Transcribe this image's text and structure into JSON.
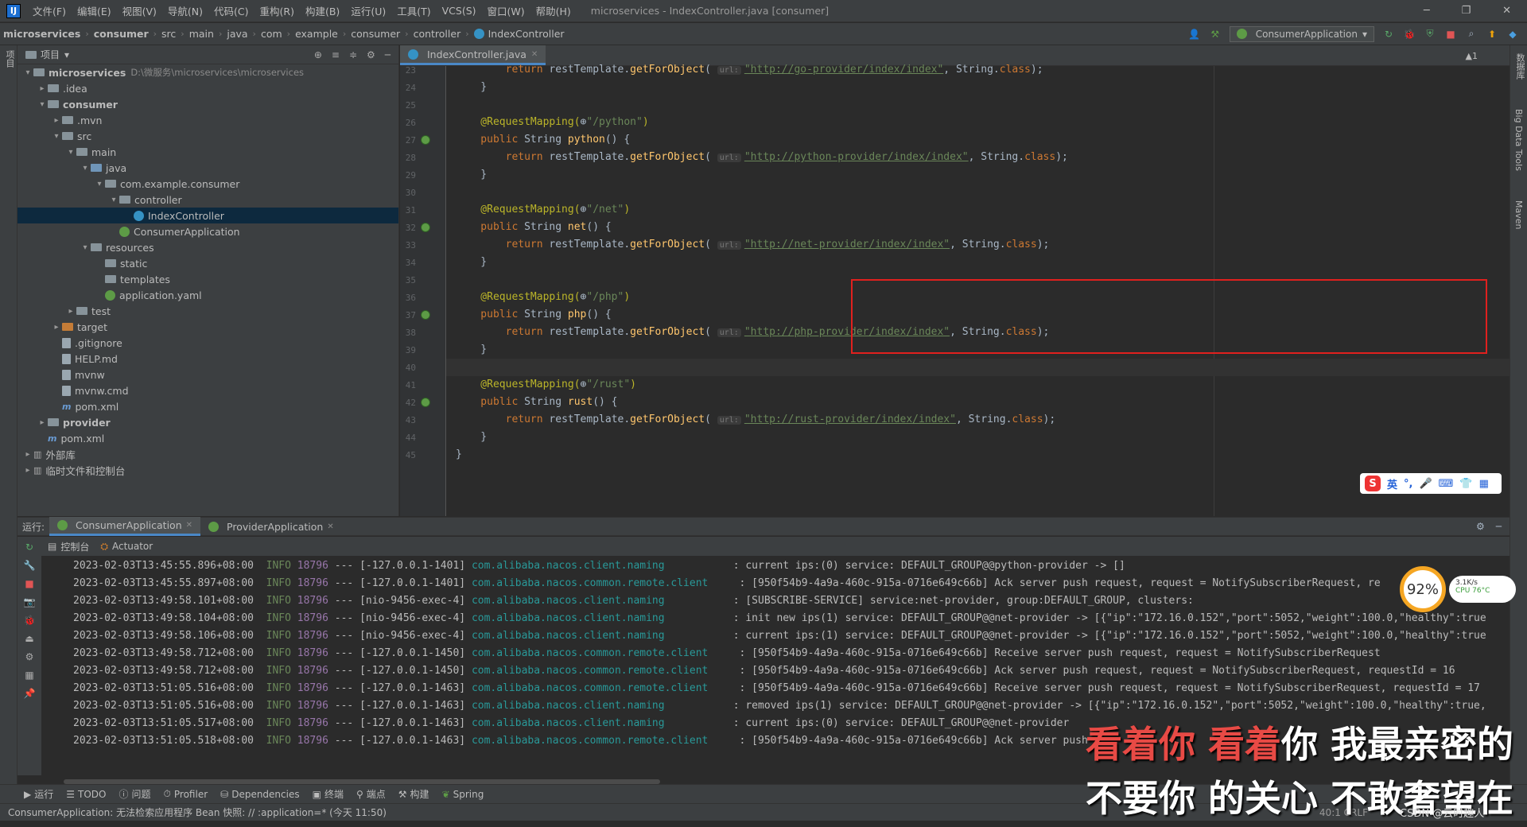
{
  "menubar": {
    "logo": "IJ",
    "items": [
      "文件(F)",
      "编辑(E)",
      "视图(V)",
      "导航(N)",
      "代码(C)",
      "重构(R)",
      "构建(B)",
      "运行(U)",
      "工具(T)",
      "VCS(S)",
      "窗口(W)",
      "帮助(H)"
    ],
    "title": "microservices - IndexController.java [consumer]"
  },
  "breadcrumb": [
    "microservices",
    "consumer",
    "src",
    "main",
    "java",
    "com",
    "example",
    "consumer",
    "controller",
    "IndexController"
  ],
  "run_config": "ConsumerApplication",
  "left_strip": {
    "project_label": "项目"
  },
  "right_strip": {
    "db_label": "数据库",
    "bigdata_label": "Big Data Tools",
    "maven_label": "Maven"
  },
  "project": {
    "header": "项目",
    "tree": [
      {
        "label": "microservices",
        "path": "D:\\微服务\\microservices\\microservices",
        "indent": 0,
        "arrow": "▾",
        "icon": "folder",
        "bold": true
      },
      {
        "label": ".idea",
        "indent": 1,
        "arrow": "▸",
        "icon": "folder"
      },
      {
        "label": "consumer",
        "indent": 1,
        "arrow": "▾",
        "icon": "folder",
        "bold": true
      },
      {
        "label": ".mvn",
        "indent": 2,
        "arrow": "▸",
        "icon": "folder"
      },
      {
        "label": "src",
        "indent": 2,
        "arrow": "▾",
        "icon": "folder"
      },
      {
        "label": "main",
        "indent": 3,
        "arrow": "▾",
        "icon": "folder"
      },
      {
        "label": "java",
        "indent": 4,
        "arrow": "▾",
        "icon": "folder-blue"
      },
      {
        "label": "com.example.consumer",
        "indent": 5,
        "arrow": "▾",
        "icon": "folder"
      },
      {
        "label": "controller",
        "indent": 6,
        "arrow": "▾",
        "icon": "folder"
      },
      {
        "label": "IndexController",
        "indent": 7,
        "arrow": "",
        "icon": "class",
        "selected": true
      },
      {
        "label": "ConsumerApplication",
        "indent": 6,
        "arrow": "",
        "icon": "spring"
      },
      {
        "label": "resources",
        "indent": 4,
        "arrow": "▾",
        "icon": "folder"
      },
      {
        "label": "static",
        "indent": 5,
        "arrow": "",
        "icon": "folder"
      },
      {
        "label": "templates",
        "indent": 5,
        "arrow": "",
        "icon": "folder"
      },
      {
        "label": "application.yaml",
        "indent": 5,
        "arrow": "",
        "icon": "spring"
      },
      {
        "label": "test",
        "indent": 3,
        "arrow": "▸",
        "icon": "folder"
      },
      {
        "label": "target",
        "indent": 2,
        "arrow": "▸",
        "icon": "folder-orange"
      },
      {
        "label": ".gitignore",
        "indent": 2,
        "arrow": "",
        "icon": "file"
      },
      {
        "label": "HELP.md",
        "indent": 2,
        "arrow": "",
        "icon": "file"
      },
      {
        "label": "mvnw",
        "indent": 2,
        "arrow": "",
        "icon": "file"
      },
      {
        "label": "mvnw.cmd",
        "indent": 2,
        "arrow": "",
        "icon": "file"
      },
      {
        "label": "pom.xml",
        "indent": 2,
        "arrow": "",
        "icon": "maven"
      },
      {
        "label": "provider",
        "indent": 1,
        "arrow": "▸",
        "icon": "folder",
        "bold": true
      },
      {
        "label": "pom.xml",
        "indent": 1,
        "arrow": "",
        "icon": "maven"
      },
      {
        "label": "外部库",
        "indent": 0,
        "arrow": "▸",
        "icon": "lib"
      },
      {
        "label": "临时文件和控制台",
        "indent": 0,
        "arrow": "▸",
        "icon": "lib"
      }
    ]
  },
  "editor": {
    "tab": "IndexController.java",
    "inspection": "▲1",
    "cursor_line": 40,
    "lines": [
      {
        "n": 23,
        "parts": [
          [
            "",
            "        "
          ],
          [
            "kw",
            "return "
          ],
          [
            "",
            "restTemplate."
          ],
          [
            "fn",
            "getForObject"
          ],
          [
            "",
            "( "
          ],
          [
            "hint",
            "url:"
          ],
          [
            "url",
            "\"http://go-provider/index/index\""
          ],
          [
            "",
            ", String."
          ],
          [
            "kw",
            "class"
          ],
          [
            "",
            ");"
          ]
        ]
      },
      {
        "n": 24,
        "parts": [
          [
            "",
            "    }"
          ]
        ]
      },
      {
        "n": 25,
        "parts": []
      },
      {
        "n": 26,
        "parts": [
          [
            "ann",
            "    @RequestMapping("
          ],
          [
            "",
            "⊕"
          ],
          [
            "str",
            "\"/python\""
          ],
          [
            "ann",
            ")"
          ]
        ]
      },
      {
        "n": 27,
        "parts": [
          [
            "kw",
            "    public "
          ],
          [
            "",
            "String "
          ],
          [
            "fn",
            "python"
          ],
          [
            "",
            "() {"
          ]
        ],
        "gicon": true
      },
      {
        "n": 28,
        "parts": [
          [
            "",
            "        "
          ],
          [
            "kw",
            "return "
          ],
          [
            "",
            "restTemplate."
          ],
          [
            "fn",
            "getForObject"
          ],
          [
            "",
            "( "
          ],
          [
            "hint",
            "url:"
          ],
          [
            "url",
            "\"http://python-provider/index/index\""
          ],
          [
            "",
            ", String."
          ],
          [
            "kw",
            "class"
          ],
          [
            "",
            ");"
          ]
        ]
      },
      {
        "n": 29,
        "parts": [
          [
            "",
            "    }"
          ]
        ]
      },
      {
        "n": 30,
        "parts": []
      },
      {
        "n": 31,
        "parts": [
          [
            "ann",
            "    @RequestMapping("
          ],
          [
            "",
            "⊕"
          ],
          [
            "str",
            "\"/net\""
          ],
          [
            "ann",
            ")"
          ]
        ]
      },
      {
        "n": 32,
        "parts": [
          [
            "kw",
            "    public "
          ],
          [
            "",
            "String "
          ],
          [
            "fn",
            "net"
          ],
          [
            "",
            "() {"
          ]
        ],
        "gicon": true
      },
      {
        "n": 33,
        "parts": [
          [
            "",
            "        "
          ],
          [
            "kw",
            "return "
          ],
          [
            "",
            "restTemplate."
          ],
          [
            "fn",
            "getForObject"
          ],
          [
            "",
            "( "
          ],
          [
            "hint",
            "url:"
          ],
          [
            "url",
            "\"http://net-provider/index/index\""
          ],
          [
            "",
            ", String."
          ],
          [
            "kw",
            "class"
          ],
          [
            "",
            ");"
          ]
        ]
      },
      {
        "n": 34,
        "parts": [
          [
            "",
            "    }"
          ]
        ]
      },
      {
        "n": 35,
        "parts": []
      },
      {
        "n": 36,
        "parts": [
          [
            "ann",
            "    @RequestMapping("
          ],
          [
            "",
            "⊕"
          ],
          [
            "str",
            "\"/php\""
          ],
          [
            "ann",
            ")"
          ]
        ]
      },
      {
        "n": 37,
        "parts": [
          [
            "kw",
            "    public "
          ],
          [
            "",
            "String "
          ],
          [
            "fn",
            "php"
          ],
          [
            "",
            "() {"
          ]
        ],
        "gicon": true
      },
      {
        "n": 38,
        "parts": [
          [
            "",
            "        "
          ],
          [
            "kw",
            "return "
          ],
          [
            "",
            "restTemplate."
          ],
          [
            "fn",
            "getForObject"
          ],
          [
            "",
            "( "
          ],
          [
            "hint",
            "url:"
          ],
          [
            "url",
            "\"http://php-provider/index/index\""
          ],
          [
            "",
            ", String."
          ],
          [
            "kw",
            "class"
          ],
          [
            "",
            ");"
          ]
        ]
      },
      {
        "n": 39,
        "parts": [
          [
            "",
            "    }"
          ]
        ]
      },
      {
        "n": 40,
        "parts": []
      },
      {
        "n": 41,
        "parts": [
          [
            "ann",
            "    @RequestMapping("
          ],
          [
            "",
            "⊕"
          ],
          [
            "str",
            "\"/rust\""
          ],
          [
            "ann",
            ")"
          ]
        ]
      },
      {
        "n": 42,
        "parts": [
          [
            "kw",
            "    public "
          ],
          [
            "",
            "String "
          ],
          [
            "fn",
            "rust"
          ],
          [
            "",
            "() {"
          ]
        ],
        "gicon": true
      },
      {
        "n": 43,
        "parts": [
          [
            "",
            "        "
          ],
          [
            "kw",
            "return "
          ],
          [
            "",
            "restTemplate."
          ],
          [
            "fn",
            "getForObject"
          ],
          [
            "",
            "( "
          ],
          [
            "hint",
            "url:"
          ],
          [
            "url",
            "\"http://rust-provider/index/index\""
          ],
          [
            "",
            ", String."
          ],
          [
            "kw",
            "class"
          ],
          [
            "",
            ");"
          ]
        ]
      },
      {
        "n": 44,
        "parts": [
          [
            "",
            "    }"
          ]
        ]
      },
      {
        "n": 45,
        "parts": [
          [
            "",
            "}"
          ]
        ]
      }
    ]
  },
  "ime": {
    "logo": "S",
    "lang": "英"
  },
  "run": {
    "label": "运行:",
    "tabs": [
      "ConsumerApplication",
      "ProviderApplication"
    ],
    "subtabs": [
      "控制台",
      "Actuator"
    ],
    "log": [
      [
        "2023-02-03T13:45:55.896+08:00",
        "INFO",
        "18796",
        "[-127.0.0.1-1401]",
        "com.alibaba.nacos.client.naming          ",
        ": current ips:(0) service: DEFAULT_GROUP@@python-provider -> []"
      ],
      [
        "2023-02-03T13:45:55.897+08:00",
        "INFO",
        "18796",
        "[-127.0.0.1-1401]",
        "com.alibaba.nacos.common.remote.client    ",
        ": [950f54b9-4a9a-460c-915a-0716e649c66b] Ack server push request, request = NotifySubscriberRequest, re"
      ],
      [
        "2023-02-03T13:49:58.101+08:00",
        "INFO",
        "18796",
        "[nio-9456-exec-4]",
        "com.alibaba.nacos.client.naming          ",
        ": [SUBSCRIBE-SERVICE] service:net-provider, group:DEFAULT_GROUP, clusters:"
      ],
      [
        "2023-02-03T13:49:58.104+08:00",
        "INFO",
        "18796",
        "[nio-9456-exec-4]",
        "com.alibaba.nacos.client.naming          ",
        ": init new ips(1) service: DEFAULT_GROUP@@net-provider -> [{\"ip\":\"172.16.0.152\",\"port\":5052,\"weight\":100.0,\"healthy\":true"
      ],
      [
        "2023-02-03T13:49:58.106+08:00",
        "INFO",
        "18796",
        "[nio-9456-exec-4]",
        "com.alibaba.nacos.client.naming          ",
        ": current ips:(1) service: DEFAULT_GROUP@@net-provider -> [{\"ip\":\"172.16.0.152\",\"port\":5052,\"weight\":100.0,\"healthy\":true"
      ],
      [
        "2023-02-03T13:49:58.712+08:00",
        "INFO",
        "18796",
        "[-127.0.0.1-1450]",
        "com.alibaba.nacos.common.remote.client    ",
        ": [950f54b9-4a9a-460c-915a-0716e649c66b] Receive server push request, request = NotifySubscriberRequest"
      ],
      [
        "2023-02-03T13:49:58.712+08:00",
        "INFO",
        "18796",
        "[-127.0.0.1-1450]",
        "com.alibaba.nacos.common.remote.client    ",
        ": [950f54b9-4a9a-460c-915a-0716e649c66b] Ack server push request, request = NotifySubscriberRequest, requestId = 16"
      ],
      [
        "2023-02-03T13:51:05.516+08:00",
        "INFO",
        "18796",
        "[-127.0.0.1-1463]",
        "com.alibaba.nacos.common.remote.client    ",
        ": [950f54b9-4a9a-460c-915a-0716e649c66b] Receive server push request, request = NotifySubscriberRequest, requestId = 17"
      ],
      [
        "2023-02-03T13:51:05.516+08:00",
        "INFO",
        "18796",
        "[-127.0.0.1-1463]",
        "com.alibaba.nacos.client.naming          ",
        ": removed ips(1) service: DEFAULT_GROUP@@net-provider -> [{\"ip\":\"172.16.0.152\",\"port\":5052,\"weight\":100.0,\"healthy\":true,"
      ],
      [
        "2023-02-03T13:51:05.517+08:00",
        "INFO",
        "18796",
        "[-127.0.0.1-1463]",
        "com.alibaba.nacos.client.naming          ",
        ": current ips:(0) service: DEFAULT_GROUP@@net-provider"
      ],
      [
        "2023-02-03T13:51:05.518+08:00",
        "INFO",
        "18796",
        "[-127.0.0.1-1463]",
        "com.alibaba.nacos.common.remote.client    ",
        ": [950f54b9-4a9a-460c-915a-0716e649c66b] Ack server push"
      ]
    ]
  },
  "cpu_widget": {
    "percent": "92%",
    "speed": "3.1K/s",
    "cpu": "CPU 76°C"
  },
  "bottom_tools": [
    "运行",
    "TODO",
    "问题",
    "Profiler",
    "Dependencies",
    "终端",
    "端点",
    "构建",
    "Spring"
  ],
  "status": {
    "message": "ConsumerApplication: 无法检索应用程序 Bean 快照: // :application=* (今天 11:50)",
    "right": "40:1  CRLF"
  },
  "subtitles": {
    "line1_red": "看着你 看着",
    "line1_white": "你 我最亲密的",
    "line2": "不要你 的关心 不敢奢望在",
    "watermark": "CSDN @云时趣人"
  }
}
